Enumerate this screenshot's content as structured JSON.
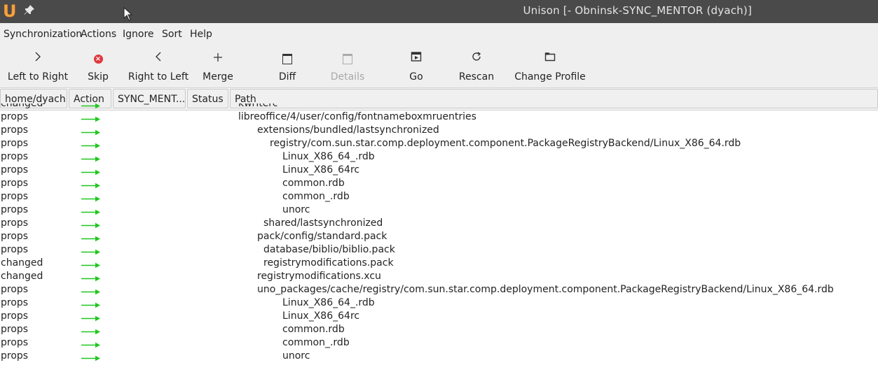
{
  "window": {
    "title": "Unison [- Obninsk-SYNC_MENTOR (dyach)]",
    "logo_glyph": "U"
  },
  "menubar": [
    "Synchronization",
    "Actions",
    "Ignore",
    "Sort",
    "Help"
  ],
  "toolbar": [
    {
      "label": "Left to Right",
      "icon": "chevron-right-icon",
      "enabled": true
    },
    {
      "label": "Skip",
      "icon": "skip-icon",
      "enabled": true
    },
    {
      "label": "Right to Left",
      "icon": "chevron-left-icon",
      "enabled": true
    },
    {
      "label": "Merge",
      "icon": "plus-icon",
      "enabled": true
    },
    {
      "label": "Diff",
      "icon": "diff-icon",
      "enabled": true
    },
    {
      "label": "Details",
      "icon": "details-icon",
      "enabled": false
    },
    {
      "label": "Go",
      "icon": "go-icon",
      "enabled": true
    },
    {
      "label": "Rescan",
      "icon": "rescan-icon",
      "enabled": true
    },
    {
      "label": "Change Profile",
      "icon": "folder-icon",
      "enabled": true
    }
  ],
  "columns": [
    "home/dyach",
    "Action",
    "SYNC_MENT...",
    "Status",
    "Path"
  ],
  "colors": {
    "arrow": "#1fc71f",
    "titlebar": "#4a4a4a",
    "toolbar": "#efefef"
  },
  "rows": [
    {
      "status": "changed",
      "action": "→",
      "path": "kwriterc"
    },
    {
      "status": "props",
      "action": "→",
      "path": "libreoffice/4/user/config/fontnameboxmruentries"
    },
    {
      "status": "props",
      "action": "→",
      "path": "extensions/bundled/lastsynchronized"
    },
    {
      "status": "props",
      "action": "→",
      "path": "registry/com.sun.star.comp.deployment.component.PackageRegistryBackend/Linux_X86_64.rdb"
    },
    {
      "status": "props",
      "action": "→",
      "path": "Linux_X86_64_.rdb"
    },
    {
      "status": "props",
      "action": "→",
      "path": "Linux_X86_64rc"
    },
    {
      "status": "props",
      "action": "→",
      "path": "common.rdb"
    },
    {
      "status": "props",
      "action": "→",
      "path": "common_.rdb"
    },
    {
      "status": "props",
      "action": "→",
      "path": "unorc"
    },
    {
      "status": "props",
      "action": "→",
      "path": "shared/lastsynchronized"
    },
    {
      "status": "props",
      "action": "→",
      "path": "pack/config/standard.pack"
    },
    {
      "status": "props",
      "action": "→",
      "path": "database/biblio/biblio.pack"
    },
    {
      "status": "changed",
      "action": "→",
      "path": "registrymodifications.pack"
    },
    {
      "status": "changed",
      "action": "→",
      "path": "registrymodifications.xcu"
    },
    {
      "status": "props",
      "action": "→",
      "path": "uno_packages/cache/registry/com.sun.star.comp.deployment.component.PackageRegistryBackend/Linux_X86_64.rdb"
    },
    {
      "status": "props",
      "action": "→",
      "path": "Linux_X86_64_.rdb"
    },
    {
      "status": "props",
      "action": "→",
      "path": "Linux_X86_64rc"
    },
    {
      "status": "props",
      "action": "→",
      "path": "common.rdb"
    },
    {
      "status": "props",
      "action": "→",
      "path": "common_.rdb"
    },
    {
      "status": "props",
      "action": "→",
      "path": "unorc"
    }
  ]
}
